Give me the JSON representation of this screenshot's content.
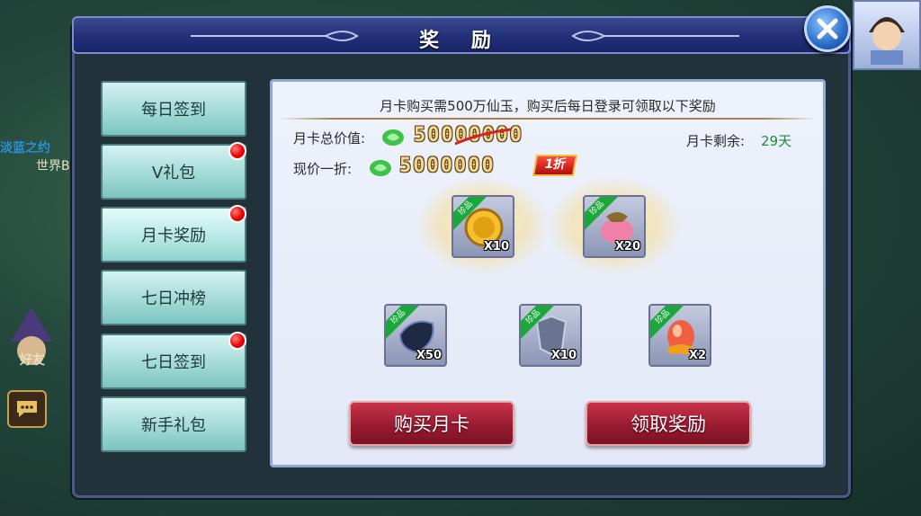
{
  "dialog": {
    "title": "奖 励",
    "close_icon": "close-icon"
  },
  "sidebar": {
    "tabs": [
      {
        "label": "每日签到",
        "badge": false
      },
      {
        "label": "V礼包",
        "badge": true
      },
      {
        "label": "月卡奖励",
        "badge": true,
        "active": true
      },
      {
        "label": "七日冲榜",
        "badge": false
      },
      {
        "label": "七日签到",
        "badge": true
      },
      {
        "label": "新手礼包",
        "badge": false
      }
    ]
  },
  "background": {
    "world_text": "淡蓝之约",
    "world_text2": "世界B",
    "friends_label": "好友"
  },
  "monthly_card": {
    "description": "月卡购买需500万仙玉，购买后每日登录可领取以下奖励",
    "total_value_label": "月卡总价值:",
    "total_value": "50000000",
    "current_price_label": "现价一折:",
    "current_price": "5000000",
    "discount_badge": "1折",
    "remaining_label": "月卡剩余:",
    "remaining_value": "29天",
    "rewards": [
      {
        "icon": "gold-coin-icon",
        "tag": "珍品",
        "count": "X10",
        "featured": true
      },
      {
        "icon": "treasure-bag-icon",
        "tag": "珍品",
        "count": "X20",
        "featured": true
      },
      {
        "icon": "dark-gem-icon",
        "tag": "珍品",
        "count": "X50",
        "featured": false
      },
      {
        "icon": "silver-armor-icon",
        "tag": "珍品",
        "count": "X10",
        "featured": false
      },
      {
        "icon": "fire-egg-icon",
        "tag": "珍品",
        "count": "X2",
        "featured": false
      }
    ],
    "buy_button": "购买月卡",
    "claim_button": "领取奖励"
  },
  "colors": {
    "title_bar": "#22307a",
    "tab_bg": "#9fd8d4",
    "panel_bg": "#e8eef9",
    "button_red": "#9a1a30",
    "remaining_green": "#1e8a3a",
    "badge_red": "#e00000"
  }
}
